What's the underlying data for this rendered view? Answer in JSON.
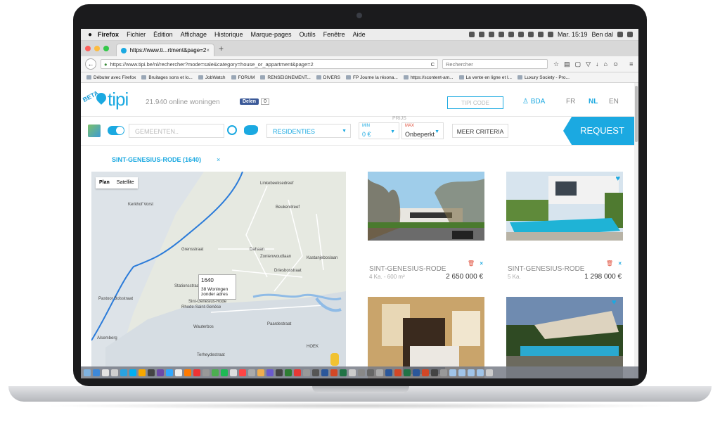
{
  "menubar": {
    "apple": "",
    "app": "Firefox",
    "items": [
      "Fichier",
      "Édition",
      "Affichage",
      "Historique",
      "Marque-pages",
      "Outils",
      "Fenêtre",
      "Aide"
    ],
    "clock": "Mar. 15:19",
    "user": "Ben dal"
  },
  "tab": {
    "title": "https://www.ti...rtment&page=2",
    "close": "×",
    "new": "+"
  },
  "nav": {
    "url": "https://www.tipi.be/nl/rechercher?mode=sale&category=house_or_appartment&page=2",
    "search_placeholder": "Rechercher",
    "back": "←",
    "reload": "C"
  },
  "bookmarks": [
    "Débuter avec Firefox",
    "Bruitages sons et lo...",
    "JobWatch",
    "FORUM",
    "RENSEIGNEMENT...",
    "DIVERS",
    "FP Journe la résona...",
    "https://scontent-am...",
    "La vente en ligne et l...",
    "Luxury Society - Pro..."
  ],
  "site": {
    "logo_beta": "BETA",
    "logo_word": "tipi",
    "online_count": "21.940 online woningen",
    "share_label": "Delen",
    "share_count": "0",
    "tipi_code_placeholder": "TIPI CODE",
    "bda_label": "BDA",
    "languages": [
      "FR",
      "NL",
      "EN"
    ],
    "active_language": "NL"
  },
  "search": {
    "gemeenten_placeholder": "GEMEENTEN..",
    "residenties": "RESIDENTIES",
    "prijs_label": "PRIJS",
    "min_label": "MIN",
    "min_value": "0 €",
    "max_label": "MAX",
    "max_value": "Onbeperkt",
    "meer_criteria": "MEER CRITERIA",
    "request": "REQUEST"
  },
  "location_filter": {
    "label": "SINT-GENESIUS-RODE (1640)",
    "remove": "×"
  },
  "map": {
    "type_buttons": [
      "Plan",
      "Satellite"
    ],
    "labels": [
      "Kerkhof Vorst",
      "Linkebeeksedreef",
      "Grensstraat",
      "Zonienwoudlaan",
      "Dahaan",
      "Driesbosstraat",
      "Stationsstraat",
      "Sint-Genesius-Rode",
      "Rhode-Saint-Genèse",
      "Paardestraat",
      "Wauterbos",
      "Terheydestraat",
      "Alsemberg",
      "HOEK",
      "Pastoor Bolsstraat",
      "Beukendreef",
      "Kastanjeboslaan"
    ],
    "popup_title": "1640",
    "popup_text_1": "38 Woningen",
    "popup_text_2": "zonder adres"
  },
  "listings": [
    {
      "title": "SINT-GENESIUS-RODE",
      "sub": "4 Ka. - 600 m²",
      "price": "2 650 000 €",
      "delete": "🗑",
      "remove": "×"
    },
    {
      "title": "SINT-GENESIUS-RODE",
      "sub": "5 Ka.",
      "price": "1 298 000 €",
      "delete": "🗑",
      "remove": "×"
    }
  ],
  "colors": {
    "accent": "#1ba9e1",
    "danger": "#e0513d"
  }
}
